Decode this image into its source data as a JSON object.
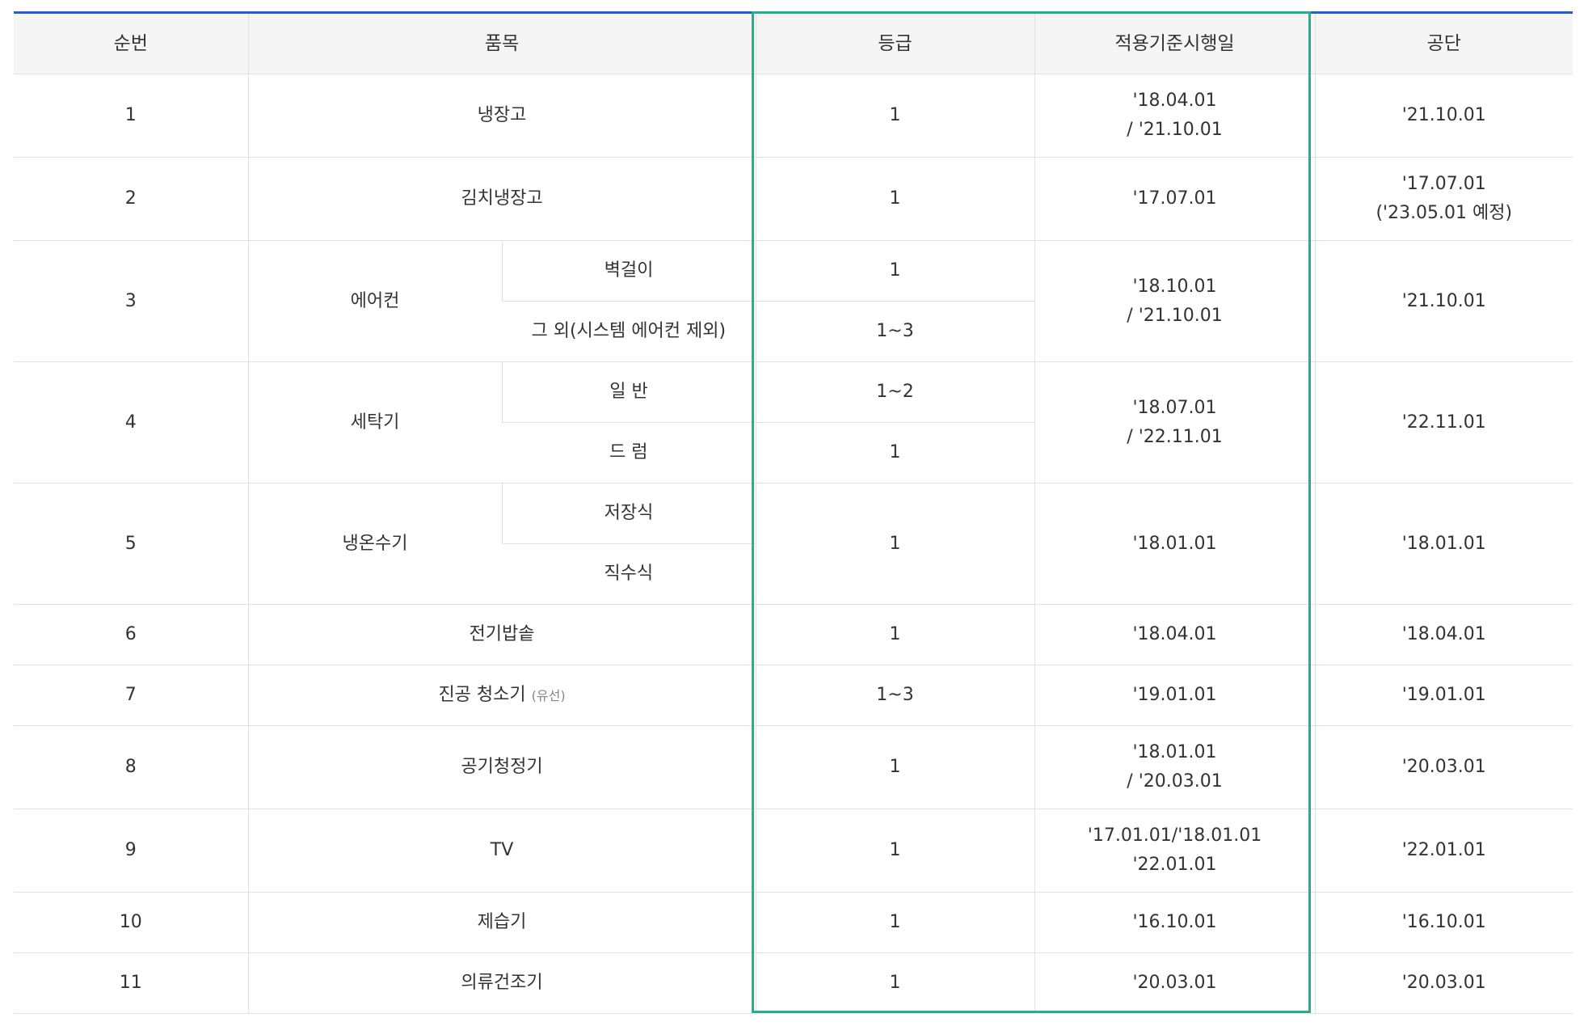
{
  "table": {
    "headers": {
      "no": "순번",
      "item": "품목",
      "grade": "등급",
      "date": "적용기준시행일",
      "public": "공단"
    },
    "rows": [
      {
        "no": "1",
        "item": "냉장고",
        "grade": "1",
        "date": [
          "'18.04.01",
          "/ '21.10.01"
        ],
        "public": [
          "'21.10.01"
        ]
      },
      {
        "no": "2",
        "item": "김치냉장고",
        "grade": "1",
        "date": [
          "'17.07.01"
        ],
        "public": [
          "'17.07.01",
          "('23.05.01 예정)"
        ]
      },
      {
        "no": "3",
        "item": "에어컨",
        "subs": [
          {
            "name": "벽걸이",
            "grade": "1"
          },
          {
            "name": "그 외(시스템 에어컨 제외)",
            "grade": "1~3"
          }
        ],
        "date": [
          "'18.10.01",
          "/ '21.10.01"
        ],
        "public": [
          "'21.10.01"
        ]
      },
      {
        "no": "4",
        "item": "세탁기",
        "subs": [
          {
            "name": "일 반",
            "grade": "1~2"
          },
          {
            "name": "드 럼",
            "grade": "1"
          }
        ],
        "date": [
          "'18.07.01",
          "/ '22.11.01"
        ],
        "public": [
          "'22.11.01"
        ]
      },
      {
        "no": "5",
        "item": "냉온수기",
        "subs": [
          {
            "name": "저장식"
          },
          {
            "name": "직수식"
          }
        ],
        "grade": "1",
        "date": [
          "'18.01.01"
        ],
        "public": [
          "'18.01.01"
        ]
      },
      {
        "no": "6",
        "item": "전기밥솥",
        "grade": "1",
        "date": [
          "'18.04.01"
        ],
        "public": [
          "'18.04.01"
        ]
      },
      {
        "no": "7",
        "item": "진공 청소기",
        "item_note": "(유선)",
        "grade": "1~3",
        "date": [
          "'19.01.01"
        ],
        "public": [
          "'19.01.01"
        ]
      },
      {
        "no": "8",
        "item": "공기청정기",
        "grade": "1",
        "date": [
          "'18.01.01",
          "/ '20.03.01"
        ],
        "public": [
          "'20.03.01"
        ]
      },
      {
        "no": "9",
        "item": "TV",
        "grade": "1",
        "date": [
          "'17.01.01/'18.01.01",
          "'22.01.01"
        ],
        "public": [
          "'22.01.01"
        ]
      },
      {
        "no": "10",
        "item": "제습기",
        "grade": "1",
        "date": [
          "'16.10.01"
        ],
        "public": [
          "'16.10.01"
        ]
      },
      {
        "no": "11",
        "item": "의류건조기",
        "grade": "1",
        "date": [
          "'20.03.01"
        ],
        "public": [
          "'20.03.01"
        ]
      }
    ]
  },
  "colors": {
    "header_top_border": "#2f5fb0",
    "highlight_border": "#3aa58c",
    "header_bg": "#f5f5f5"
  }
}
